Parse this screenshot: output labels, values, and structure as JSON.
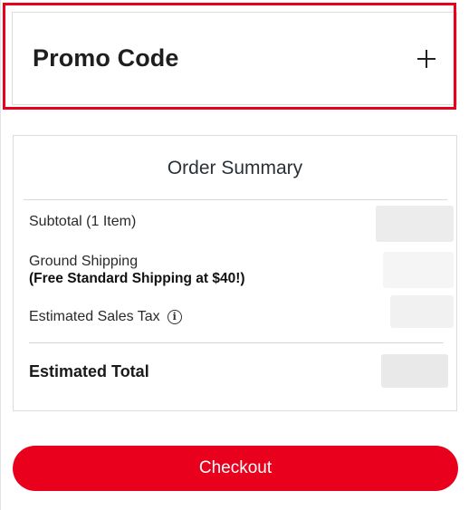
{
  "promo": {
    "title": "Promo Code",
    "toggle_icon": "plus-icon"
  },
  "summary": {
    "title": "Order Summary",
    "rows": [
      {
        "label": "Subtotal (1 Item)"
      },
      {
        "label": "Ground Shipping",
        "note": "(Free Standard Shipping at $40!)"
      },
      {
        "label": "Estimated Sales Tax",
        "icon": "info-icon"
      }
    ],
    "total_label": "Estimated Total"
  },
  "checkout": {
    "label": "Checkout"
  },
  "colors": {
    "accent": "#e8001c",
    "highlight_border": "#e8001c",
    "text": "#1f1f1f",
    "border": "#dcdcdc"
  }
}
